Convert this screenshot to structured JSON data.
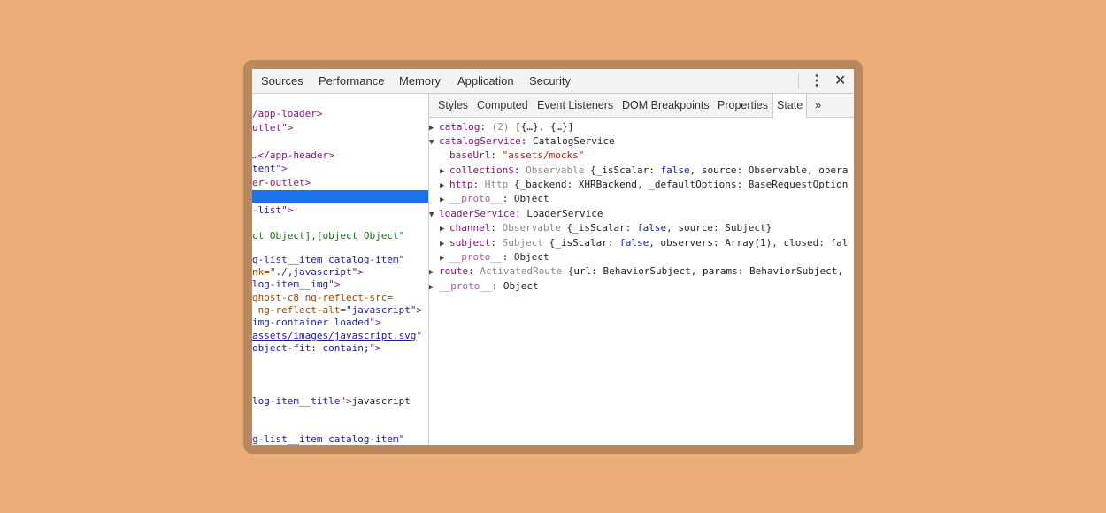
{
  "top_tabs": [
    "Sources",
    "Performance",
    "Memory",
    "Application",
    "Security"
  ],
  "sub_tabs": [
    "Styles",
    "Computed",
    "Event Listeners",
    "DOM Breakpoints",
    "Properties",
    "State"
  ],
  "more_label": "»",
  "kebab_icon": "⋮",
  "close_icon": "✕",
  "elements": {
    "l1": "/app-loader>",
    "l2": "utlet\">",
    "l3": "…</app-header>",
    "l4a": "tent",
    "l4b": "\">",
    "l5": "er-outlet>",
    "l6a": "-list",
    "l6b": "\">",
    "l7": "ct Object],[object Object\"",
    "l8": "g-list__item catalog-item\"",
    "l9a": "nk=",
    "l9b": "\"./,javascript\"",
    "l9c": ">",
    "l10a": "log-item__img",
    "l10b": "\">",
    "l11a": "ghost-c8 ng-reflect-src=",
    "l12a": " ng-reflect-alt=",
    "l12b": "\"javascript\"",
    "l12c": ">",
    "l13a": "img-container loaded",
    "l13b": "\">",
    "l14": "assets/images/javascript.svg",
    "l14b": "\"",
    "l15a": "object-fit: contain;",
    "l15b": "\">",
    "l16a": "log-item__title",
    "l16b": "\">",
    "l16c": "javascript",
    "l17": "g-list__item catalog-item\""
  },
  "state": {
    "r1_key": "catalog",
    "r1_count": "(2)",
    "r1_val": "[{…}, {…}]",
    "r2_key": "catalogService",
    "r2_val": "CatalogService",
    "r3_key": "baseUrl",
    "r3_val": "\"assets/mocks\"",
    "r4_key": "collection$",
    "r4_type": "Observable",
    "r4_a": "{_isScalar: ",
    "r4_b": "false",
    "r4_c": ", source: Observable, opera",
    "r5_key": "http",
    "r5_type": "Http",
    "r5_val": "{_backend: XHRBackend, _defaultOptions: BaseRequestOption",
    "r6_key": "__proto__",
    "r6_val": "Object",
    "r7_key": "loaderService",
    "r7_val": "LoaderService",
    "r8_key": "channel",
    "r8_type": "Observable",
    "r8_a": "{_isScalar: ",
    "r8_b": "false",
    "r8_c": ", source: Subject}",
    "r9_key": "subject",
    "r9_type": "Subject",
    "r9_a": "{_isScalar: ",
    "r9_b": "false",
    "r9_c": ", observers: Array(1), closed: fal",
    "r10_key": "__proto__",
    "r10_val": "Object",
    "r11_key": "route",
    "r11_type": "ActivatedRoute",
    "r11_val": "{url: BehaviorSubject, params: BehaviorSubject,",
    "r12_key": "__proto__",
    "r12_val": "Object"
  },
  "colors": {
    "background": "#ecae78",
    "frame": "#b9885f",
    "selection": "#1a73e8"
  }
}
